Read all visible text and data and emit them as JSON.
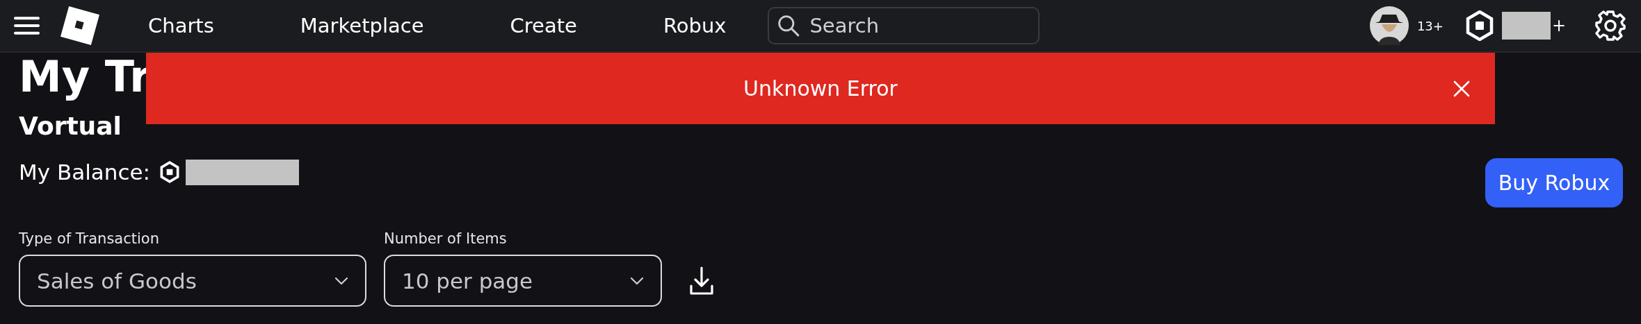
{
  "top_bar": {
    "nav_items": [
      "Charts",
      "Marketplace",
      "Create",
      "Robux"
    ],
    "search": {
      "placeholder": "Search"
    },
    "age_badge": "13+",
    "robux_plus": "+"
  },
  "title": "My Tr",
  "alert": {
    "message": "Unknown Error"
  },
  "username": "Vortual",
  "balance_label": "My Balance:",
  "buy_button": "Buy Robux",
  "filters": [
    {
      "label": "Type of Transaction",
      "value": "Sales of Goods"
    },
    {
      "label": "Number of Items",
      "value": "10 per page"
    }
  ]
}
